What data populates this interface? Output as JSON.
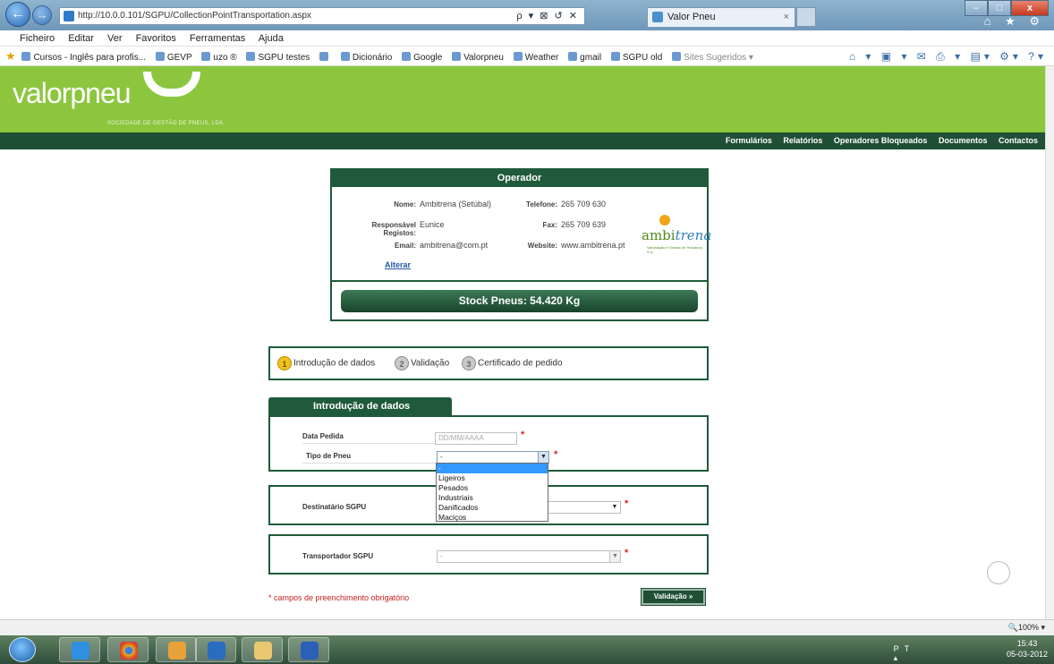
{
  "browser": {
    "url": "http://10.0.0.101/SGPU/CollectionPointTransportation.aspx",
    "address_controls": "ρ ▾ ⊠ ↺ ✕",
    "tab_title": "Valor Pneu",
    "tab_close": "×",
    "win_minimize": "–",
    "win_maximize": "□",
    "win_close": "x",
    "menu": [
      "Ficheiro",
      "Editar",
      "Ver",
      "Favoritos",
      "Ferramentas",
      "Ajuda"
    ],
    "favorites": [
      "Cursos - Inglês para profis...",
      "GEVP",
      "uzo ®",
      "SGPU testes",
      "",
      "Dicionário",
      "Google",
      "Valorpneu",
      "Weather",
      "gmail",
      "SGPU old"
    ],
    "favorites_suggested": "Sites Sugeridos ▾",
    "command_icons": "⌂ ▾ ▣ ▾ ✉ ⎙ ▾ ▤▾ ⚙▾ ?▾",
    "toolbar_right_icons": "⌂ ★ ⚙"
  },
  "site": {
    "logo": "valorpneu",
    "tagline": "SOCIEDADE DE GESTÃO DE PNEUS, LDA.",
    "nav": [
      "Formulários",
      "Relatórios",
      "Operadores Bloqueados",
      "Documentos",
      "Contactos"
    ]
  },
  "operator": {
    "heading": "Operador",
    "labels": {
      "name": "Nome:",
      "responsible": "Responsável Registos:",
      "email": "Email:",
      "phone": "Telefone:",
      "fax": "Fax:",
      "website": "Website:"
    },
    "name": "Ambitrena (Setúbal)",
    "responsible": "Eunice",
    "email": "ambitrena@com.pt",
    "phone": "265 709 630",
    "fax": "265 709 639",
    "website": "www.ambitrena.pt",
    "edit_link": "Alterar",
    "logo_text_a": "ambi",
    "logo_text_b": "trena",
    "logo_sub": "Valorização e Gestão de Resíduos, S.A."
  },
  "stock": {
    "label": "Stock Pneus: 54.420 Kg"
  },
  "steps": [
    {
      "num": "1",
      "label": "Introdução de dados",
      "active": true
    },
    {
      "num": "2",
      "label": "Validação",
      "active": false
    },
    {
      "num": "3",
      "label": "Certificado de pedido",
      "active": false
    }
  ],
  "form": {
    "tab_title": "Introdução de dados",
    "date_label": "Data Pedida",
    "date_placeholder": "DD/MM/AAAA",
    "tire_type_label": "Tipo de Pneu",
    "tire_type_value": "-",
    "tire_type_options": [
      "-",
      "Ligeiros",
      "Pesados",
      "Industriais",
      "Danificados",
      "Maciços"
    ],
    "tire_type_selected_index": 0,
    "recipient_label": "Destinatário SGPU",
    "carrier_label": "Transportador SGPU",
    "carrier_value": "-",
    "required_mark": "*",
    "mandatory_note": "* campos de preenchimento obrigatório",
    "submit_label": "Validação »"
  },
  "status": {
    "zoom": "🔍100%  ▾"
  },
  "taskbar": {
    "lang": "PT ▴ ▢ ◂ ▭",
    "time": "15:43",
    "date": "05-03-2012"
  }
}
